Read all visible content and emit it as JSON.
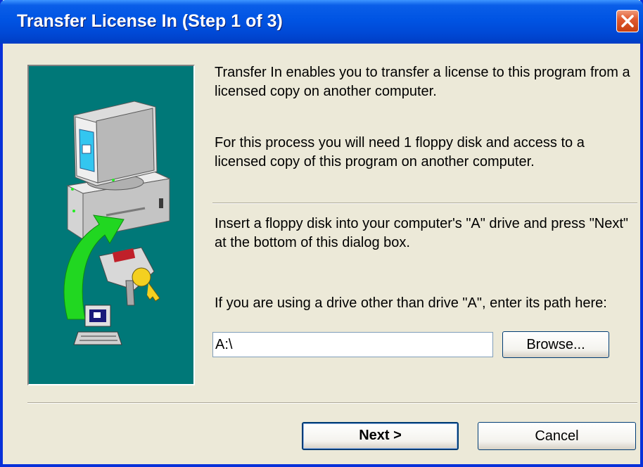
{
  "window": {
    "title": "Transfer License In (Step 1 of 3)",
    "close_icon": "close-icon"
  },
  "content": {
    "intro": "Transfer In enables you to transfer a license to this program from a licensed copy on another computer.",
    "requirement": "For this process you will need 1 floppy disk and access to a licensed copy of this program on another computer.",
    "instruction": "Insert a floppy disk into your computer's \"A\" drive and press \"Next\" at the bottom of this dialog box.",
    "path_prompt": "If you are using a drive other than drive \"A\", enter its path here:"
  },
  "path": {
    "value": "A:\\"
  },
  "buttons": {
    "browse": "Browse...",
    "next": "Next >",
    "cancel": "Cancel"
  },
  "illustration": {
    "icons": [
      "monitor-icon",
      "computer-tower-icon",
      "green-arrow-icon",
      "keys-icon",
      "laptop-icon"
    ]
  },
  "colors": {
    "title_bar": "#0054e3",
    "window_bg": "#ece9d8",
    "art_bg": "#007878",
    "close_button": "#e05a30"
  }
}
